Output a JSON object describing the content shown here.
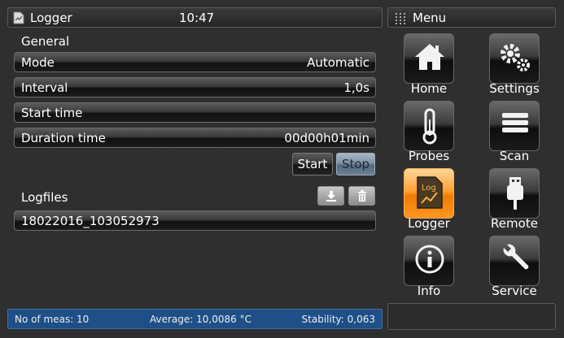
{
  "header": {
    "title": "Logger",
    "time": "10:47",
    "icon": "logger-doc-icon"
  },
  "menu": {
    "title": "Menu",
    "icon": "grip-dots-icon"
  },
  "general": {
    "section_label": "General",
    "fields": [
      {
        "label": "Mode",
        "value": "Automatic"
      },
      {
        "label": "Interval",
        "value": "1,0s"
      },
      {
        "label": "Start time",
        "value": ""
      },
      {
        "label": "Duration time",
        "value": "00d00h01min"
      }
    ],
    "start_label": "Start",
    "stop_label": "Stop"
  },
  "logfiles": {
    "section_label": "Logfiles",
    "download_icon": "download-icon",
    "delete_icon": "trash-icon",
    "items": [
      "18022016_103052973"
    ]
  },
  "tiles": [
    {
      "label": "Home",
      "icon": "home-icon"
    },
    {
      "label": "Settings",
      "icon": "gears-icon"
    },
    {
      "label": "Probes",
      "icon": "thermometer-icon"
    },
    {
      "label": "Scan",
      "icon": "stack-icon"
    },
    {
      "label": "Logger",
      "icon": "log-chart-icon",
      "active": true
    },
    {
      "label": "Remote",
      "icon": "usb-icon"
    },
    {
      "label": "Info",
      "icon": "info-icon"
    },
    {
      "label": "Service",
      "icon": "wrench-icon"
    }
  ],
  "status": {
    "meas": "No of meas: 10",
    "average": "Average: 10,0086 °C",
    "stability": "Stability: 0,063"
  },
  "colors": {
    "active_tile": "#ff9a1f",
    "status_bar": "#1f4f86",
    "stop_active": "#7f92a6"
  }
}
